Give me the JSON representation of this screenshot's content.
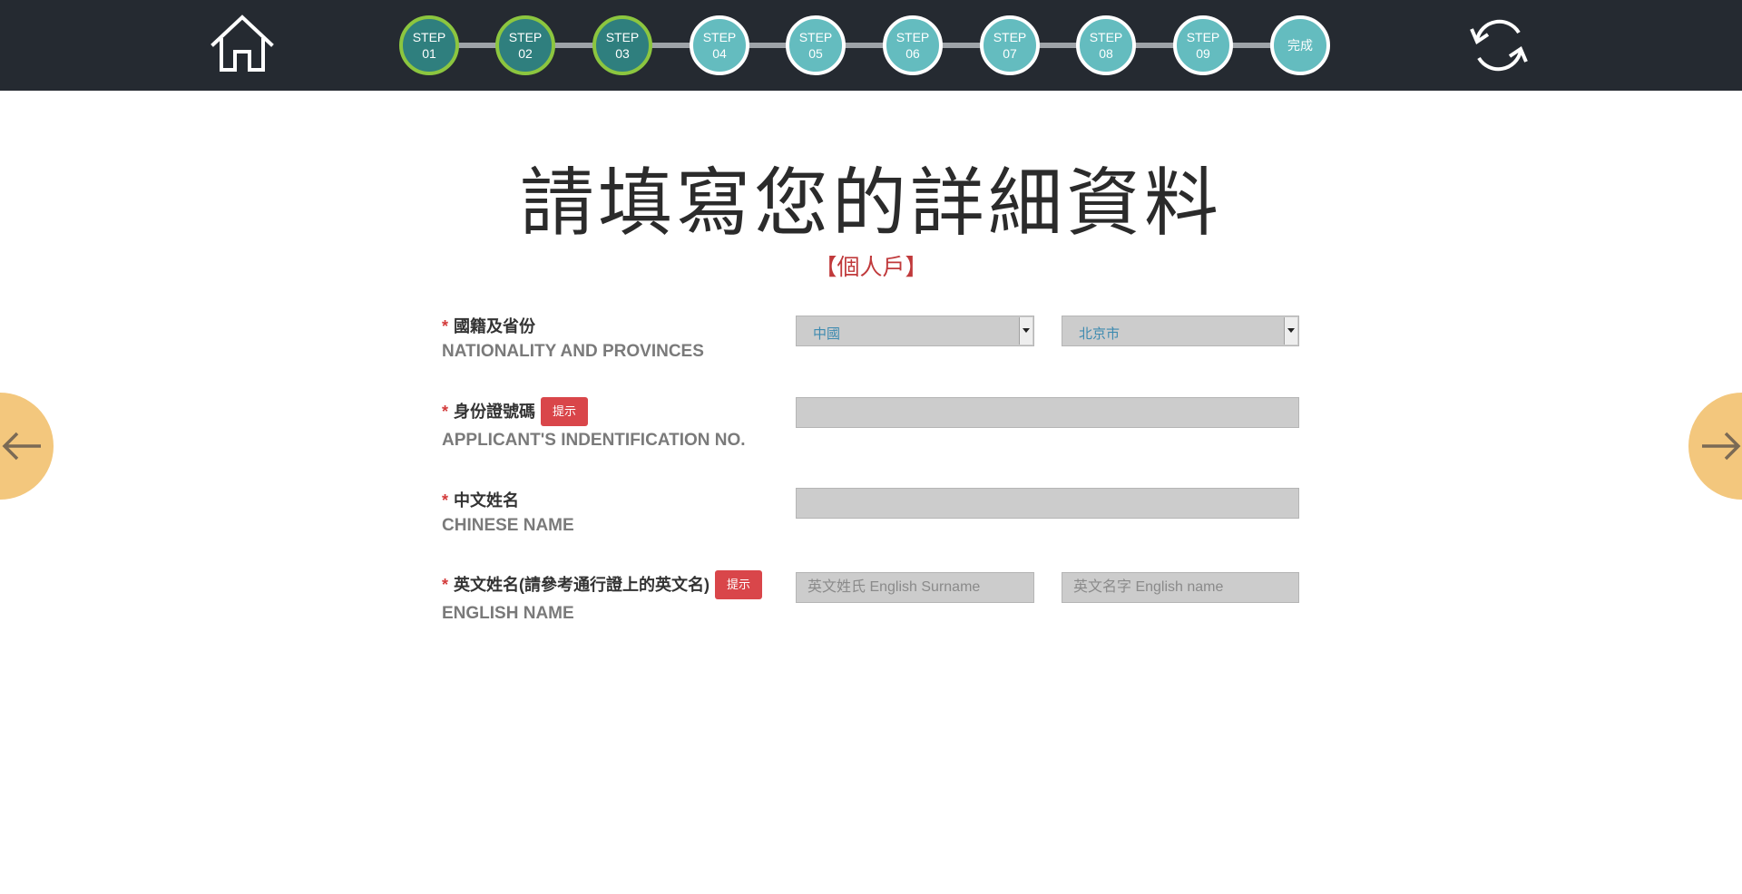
{
  "header": {
    "steps": [
      {
        "line1": "STEP",
        "line2": "01",
        "done": true
      },
      {
        "line1": "STEP",
        "line2": "02",
        "done": true
      },
      {
        "line1": "STEP",
        "line2": "03",
        "done": true
      },
      {
        "line1": "STEP",
        "line2": "04",
        "done": false
      },
      {
        "line1": "STEP",
        "line2": "05",
        "done": false
      },
      {
        "line1": "STEP",
        "line2": "06",
        "done": false
      },
      {
        "line1": "STEP",
        "line2": "07",
        "done": false
      },
      {
        "line1": "STEP",
        "line2": "08",
        "done": false
      },
      {
        "line1": "STEP",
        "line2": "09",
        "done": false
      }
    ],
    "finish_label": "完成",
    "home_icon": "home-icon",
    "refresh_icon": "refresh-icon"
  },
  "main": {
    "title": "請填寫您的詳細資料",
    "subtitle": "【個人戶】"
  },
  "form": {
    "required_mark": "*",
    "hint_label": "提示",
    "nationality": {
      "label_zh": "國籍及省份",
      "label_en": "NATIONALITY AND PROVINCES",
      "country_value": "中國",
      "province_value": "北京市"
    },
    "id_number": {
      "label_zh": "身份證號碼",
      "label_en": "APPLICANT'S INDENTIFICATION NO.",
      "value": ""
    },
    "chinese_name": {
      "label_zh": "中文姓名",
      "label_en": "CHINESE NAME",
      "value": ""
    },
    "english_name": {
      "label_zh": "英文姓名(請參考通行證上的英文名)",
      "label_en": "ENGLISH NAME",
      "surname_placeholder": "英文姓氏 English Surname",
      "name_placeholder": "英文名字 English name"
    }
  },
  "nav": {
    "prev_icon": "arrow-left-icon",
    "next_icon": "arrow-right-icon"
  },
  "colors": {
    "topbar": "#252a31",
    "step_done": "#2f7f7e",
    "step_done_ring": "#8cc63f",
    "step_pending": "#64bcbf",
    "hint_button": "#d9464a",
    "nav_arrow": "#f3c77d",
    "subtitle": "#c0393b"
  }
}
